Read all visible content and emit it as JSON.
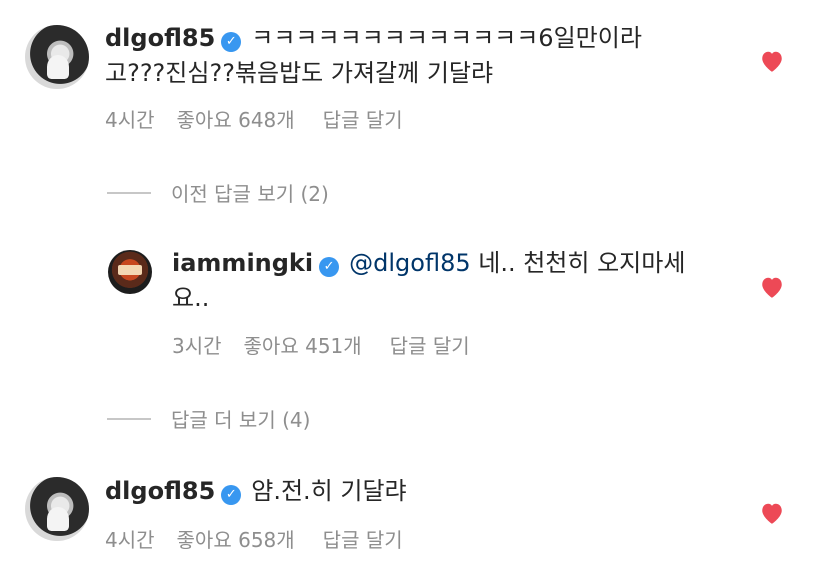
{
  "comments": [
    {
      "username": "dlgofl85",
      "text_line1": "ㅋㅋㅋㅋㅋㅋㅋㅋㅋㅋㅋㅋㅋ6일만이라",
      "text_line2": "고???진심??볶음밥도 가져갈께 기달랴",
      "time": "4시간",
      "likes": "좋아요 648개",
      "reply": "답글 달기"
    },
    {
      "username": "iammingki",
      "mention": "@dlgofl85",
      "text_line1": " 네.. 천천히 오지마세",
      "text_line2": "요..",
      "time": "3시간",
      "likes": "좋아요 451개",
      "reply": "답글 달기"
    },
    {
      "username": "dlgofl85",
      "text_line1": "얌.전.히 기달랴",
      "time": "4시간",
      "likes": "좋아요 658개",
      "reply": "답글 달기"
    }
  ],
  "threads": {
    "view_previous": "이전 답글 보기 (2)",
    "view_more": "답글 더 보기 (4)"
  },
  "colors": {
    "heart": "#ed4956",
    "verified": "#3897f0",
    "meta": "#8e8e8e"
  },
  "icons": {
    "verified": "verified-badge-icon",
    "like": "heart-icon"
  }
}
